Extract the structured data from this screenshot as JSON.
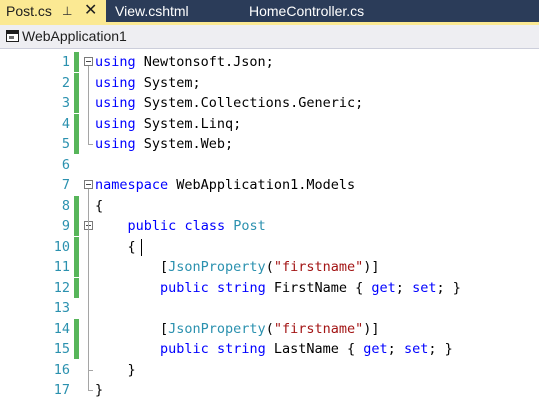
{
  "tabs": {
    "active": {
      "label": "Post.cs",
      "pin_icon": "pin-icon",
      "close_icon": "close-icon"
    },
    "others": [
      {
        "label": "View.cshtml"
      },
      {
        "label": "HomeController.cs"
      }
    ]
  },
  "navbar": {
    "project": "WebApplication1",
    "project_icon": "csharp-project-icon"
  },
  "editor": {
    "colors": {
      "keyword": "#0000ff",
      "type": "#2b91af",
      "string": "#a31515",
      "change_bar": "#57b55a",
      "active_tab": "#fbe993"
    },
    "caret_line": 10,
    "lines": [
      {
        "n": "1",
        "changed": true,
        "tokens": [
          [
            "kw",
            "using"
          ],
          [
            "p",
            " Newtonsoft.Json;"
          ]
        ]
      },
      {
        "n": "2",
        "changed": true,
        "tokens": [
          [
            "kw",
            "using"
          ],
          [
            "p",
            " System;"
          ]
        ]
      },
      {
        "n": "3",
        "changed": true,
        "tokens": [
          [
            "kw",
            "using"
          ],
          [
            "p",
            " System.Collections.Generic;"
          ]
        ]
      },
      {
        "n": "4",
        "changed": true,
        "tokens": [
          [
            "kw",
            "using"
          ],
          [
            "p",
            " System.Linq;"
          ]
        ]
      },
      {
        "n": "5",
        "changed": true,
        "tokens": [
          [
            "kw",
            "using"
          ],
          [
            "p",
            " System.Web;"
          ]
        ]
      },
      {
        "n": "6",
        "changed": false,
        "tokens": []
      },
      {
        "n": "7",
        "changed": false,
        "tokens": [
          [
            "kw",
            "namespace"
          ],
          [
            "p",
            " WebApplication1.Models"
          ]
        ]
      },
      {
        "n": "8",
        "changed": true,
        "tokens": [
          [
            "p",
            "{"
          ]
        ]
      },
      {
        "n": "9",
        "changed": true,
        "tokens": [
          [
            "p",
            "    "
          ],
          [
            "kw",
            "public"
          ],
          [
            "p",
            " "
          ],
          [
            "kw",
            "class"
          ],
          [
            "p",
            " "
          ],
          [
            "ty",
            "Post"
          ]
        ]
      },
      {
        "n": "10",
        "changed": true,
        "tokens": [
          [
            "p",
            "    {"
          ]
        ]
      },
      {
        "n": "11",
        "changed": true,
        "tokens": [
          [
            "p",
            "        ["
          ],
          [
            "ty",
            "JsonProperty"
          ],
          [
            "p",
            "("
          ],
          [
            "str",
            "\"firstname\""
          ],
          [
            "p",
            ")]"
          ]
        ]
      },
      {
        "n": "12",
        "changed": true,
        "tokens": [
          [
            "p",
            "        "
          ],
          [
            "kw",
            "public"
          ],
          [
            "p",
            " "
          ],
          [
            "kw",
            "string"
          ],
          [
            "p",
            " FirstName { "
          ],
          [
            "kw",
            "get"
          ],
          [
            "p",
            "; "
          ],
          [
            "kw",
            "set"
          ],
          [
            "p",
            "; }"
          ]
        ]
      },
      {
        "n": "13",
        "changed": false,
        "tokens": []
      },
      {
        "n": "14",
        "changed": true,
        "tokens": [
          [
            "p",
            "        ["
          ],
          [
            "ty",
            "JsonProperty"
          ],
          [
            "p",
            "("
          ],
          [
            "str",
            "\"firstname\""
          ],
          [
            "p",
            ")]"
          ]
        ]
      },
      {
        "n": "15",
        "changed": true,
        "tokens": [
          [
            "p",
            "        "
          ],
          [
            "kw",
            "public"
          ],
          [
            "p",
            " "
          ],
          [
            "kw",
            "string"
          ],
          [
            "p",
            " LastName { "
          ],
          [
            "kw",
            "get"
          ],
          [
            "p",
            "; "
          ],
          [
            "kw",
            "set"
          ],
          [
            "p",
            "; }"
          ]
        ]
      },
      {
        "n": "16",
        "changed": false,
        "tokens": [
          [
            "p",
            "    }"
          ]
        ]
      },
      {
        "n": "17",
        "changed": false,
        "tokens": [
          [
            "p",
            "}"
          ]
        ]
      }
    ]
  }
}
